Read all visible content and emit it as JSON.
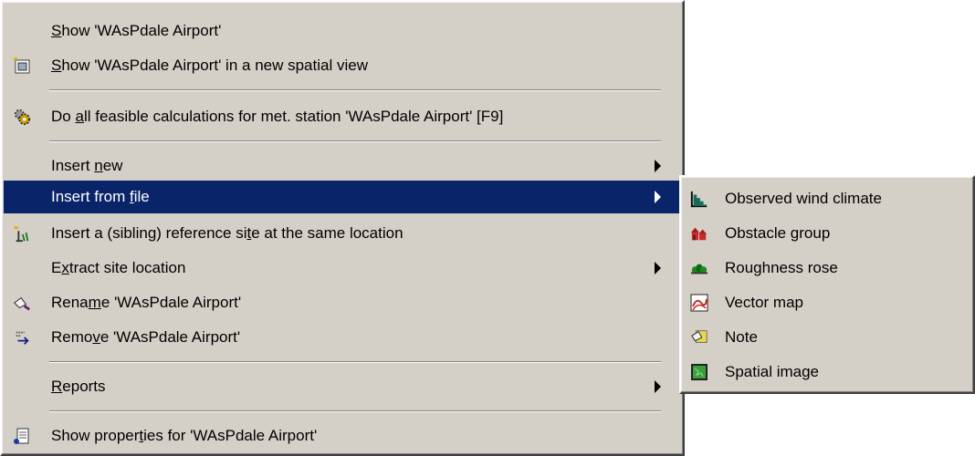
{
  "main_menu": {
    "items": [
      {
        "pre": "",
        "acc": "S",
        "post": "how 'WAsPdale Airport'",
        "icon": "none"
      },
      {
        "pre": "",
        "acc": "S",
        "post": "how 'WAsPdale Airport' in a new spatial view",
        "icon": "new-spatial-view-icon"
      },
      {
        "pre": "Do ",
        "acc": "a",
        "post": "ll feasible calculations for met. station 'WAsPdale Airport' [F9]",
        "icon": "calculations-gears-icon"
      },
      {
        "pre": "Insert ",
        "acc": "n",
        "post": "ew",
        "icon": "none",
        "submenu": true
      },
      {
        "pre": "Insert from ",
        "acc": "f",
        "post": "ile",
        "icon": "none",
        "submenu": true,
        "selected": true
      },
      {
        "pre": "Insert a (sibling) reference si",
        "acc": "t",
        "post": "e at the same location",
        "icon": "reference-site-icon"
      },
      {
        "pre": "E",
        "acc": "x",
        "post": "tract site location",
        "icon": "none",
        "submenu": true
      },
      {
        "pre": "Rena",
        "acc": "m",
        "post": "e 'WAsPdale Airport'",
        "icon": "rename-icon"
      },
      {
        "pre": "Remo",
        "acc": "v",
        "post": "e 'WAsPdale Airport'",
        "icon": "remove-icon"
      },
      {
        "pre": "",
        "acc": "R",
        "post": "eports",
        "icon": "none",
        "submenu": true
      },
      {
        "pre": "Show proper",
        "acc": "t",
        "post": "ies for 'WAsPdale Airport'",
        "icon": "properties-icon"
      }
    ]
  },
  "submenu": {
    "items": [
      {
        "label": "Observed wind climate",
        "icon": "wind-climate-icon"
      },
      {
        "label": "Obstacle group",
        "icon": "obstacle-group-icon"
      },
      {
        "label": "Roughness rose",
        "icon": "roughness-rose-icon"
      },
      {
        "label": "Vector map",
        "icon": "vector-map-icon"
      },
      {
        "label": "Note",
        "icon": "note-icon"
      },
      {
        "label": "Spatial image",
        "icon": "spatial-image-icon"
      }
    ]
  },
  "colors": {
    "menu_background": "#d4d0c8",
    "highlight": "#0a246a",
    "highlight_text": "#ffffff"
  }
}
